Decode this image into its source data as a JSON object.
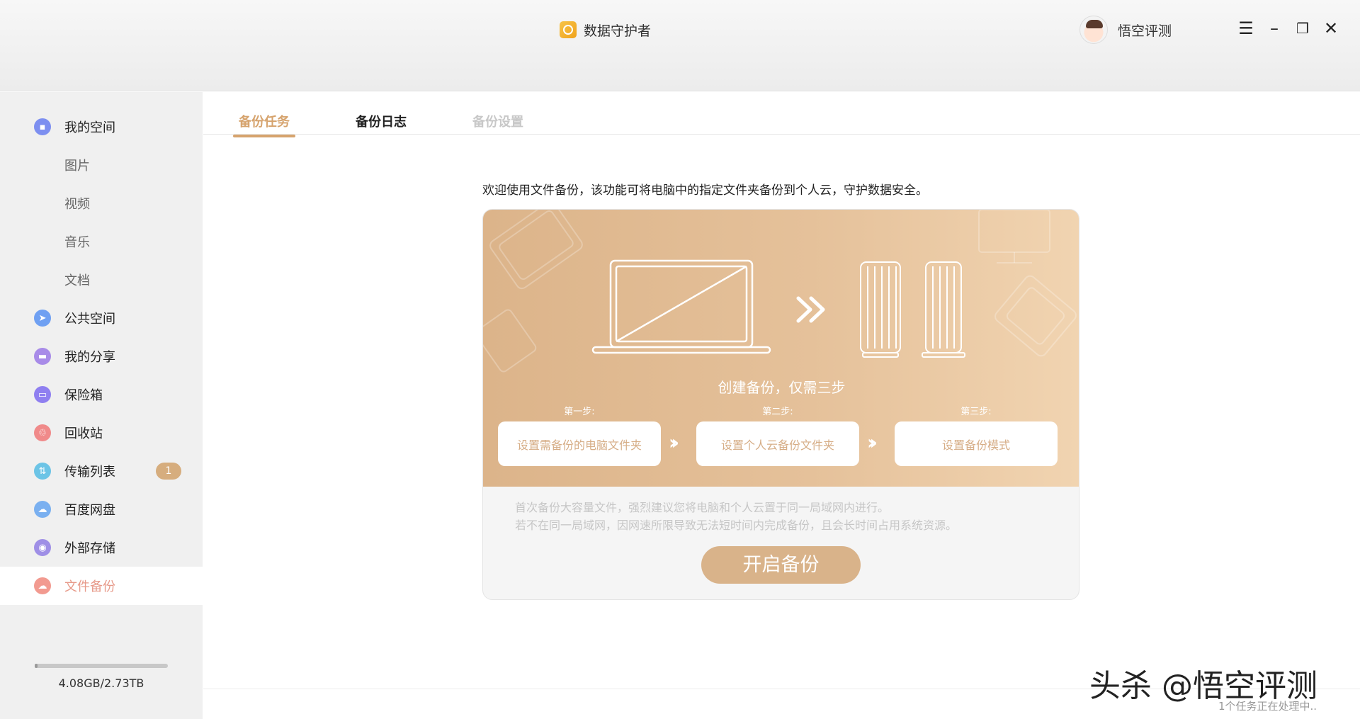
{
  "window": {
    "title": "数据守护者",
    "user_name": "悟空评测",
    "controls": [
      "menu-icon",
      "minimize-icon",
      "restore-icon",
      "close-icon"
    ]
  },
  "sidebar": {
    "items": [
      {
        "label": "我的空间",
        "icon": "my-space-icon",
        "color": "#7d8ff0"
      },
      {
        "label": "图片",
        "sub": true
      },
      {
        "label": "视频",
        "sub": true
      },
      {
        "label": "音乐",
        "sub": true
      },
      {
        "label": "文档",
        "sub": true
      },
      {
        "label": "公共空间",
        "icon": "public-space-icon",
        "color": "#6fa0f2"
      },
      {
        "label": "我的分享",
        "icon": "share-icon",
        "color": "#a88be8"
      },
      {
        "label": "保险箱",
        "icon": "safe-icon",
        "color": "#8f7ff0"
      },
      {
        "label": "回收站",
        "icon": "recycle-bin-icon",
        "color": "#f08a8a"
      },
      {
        "label": "传输列表",
        "icon": "transfer-icon",
        "color": "#6cc4e6",
        "badge": "1"
      },
      {
        "label": "百度网盘",
        "icon": "baidu-pan-icon",
        "color": "#7ab0f0"
      },
      {
        "label": "外部存储",
        "icon": "external-storage-icon",
        "color": "#9f8fe6"
      },
      {
        "label": "文件备份",
        "icon": "backup-icon",
        "color": "#f29a90",
        "active": true
      }
    ],
    "storage": {
      "text": "4.08GB/2.73TB",
      "used_fraction": 0.0015
    }
  },
  "tabs": [
    {
      "label": "备份任务",
      "state": "active"
    },
    {
      "label": "备份日志",
      "state": "normal"
    },
    {
      "label": "备份设置",
      "state": "disabled"
    }
  ],
  "main": {
    "intro": "欢迎使用文件备份，该功能可将电脑中的指定文件夹备份到个人云，守护数据安全。",
    "hero_title": "创建备份，仅需三步",
    "steps": [
      {
        "label": "第一步:",
        "action": "设置需备份的电脑文件夹"
      },
      {
        "label": "第二步:",
        "action": "设置个人云备份文件夹"
      },
      {
        "label": "第三步:",
        "action": "设置备份模式"
      }
    ],
    "tips": [
      "首次备份大容量文件，强烈建议您将电脑和个人云置于同一局域网内进行。",
      "若不在同一局域网，因网速所限导致无法短时间内完成备份，且会长时间占用系统资源。"
    ],
    "start_button": "开启备份"
  },
  "footer": {
    "watermark": "头杀 @悟空评测",
    "status": "1个任务正在处理中.."
  },
  "colors": {
    "accent": "#d6a36d",
    "active_nav": "#e79a8a"
  }
}
